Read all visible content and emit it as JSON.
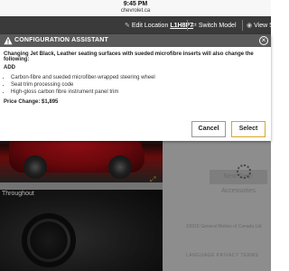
{
  "status_bar": {
    "time": "9:45 PM",
    "url": "chevrolet.ca"
  },
  "header": {
    "edit_location": "Edit Location",
    "location_code": "L1H8P7",
    "switch_model": "Switch Model",
    "view": "View S"
  },
  "background": {
    "interior_label": "Throughout",
    "next_step": "Next Step: Accessories",
    "footer_text": "©2016 General Motors of Canada Ltd.",
    "footer_links": "LANGUAGE  PRIVACY  TERMS"
  },
  "modal": {
    "title": "CONFIGURATION ASSISTANT",
    "message": "Changing Jet Black, Leather seating surfaces with sueded microfibre inserts will also change the following:",
    "add_label": "ADD",
    "items": [
      "Carbon-fibre and sueded microfiber-wrapped steering wheel",
      "Seat trim processing code",
      "High-gloss carbon fibre instrument panel trim"
    ],
    "price_change": "Price Change: $1,895",
    "cancel_label": "Cancel",
    "select_label": "Select",
    "colors": {
      "title_bar": "#5a5a5a",
      "accent": "#d8a62a",
      "header": "#3a3a3a"
    }
  }
}
